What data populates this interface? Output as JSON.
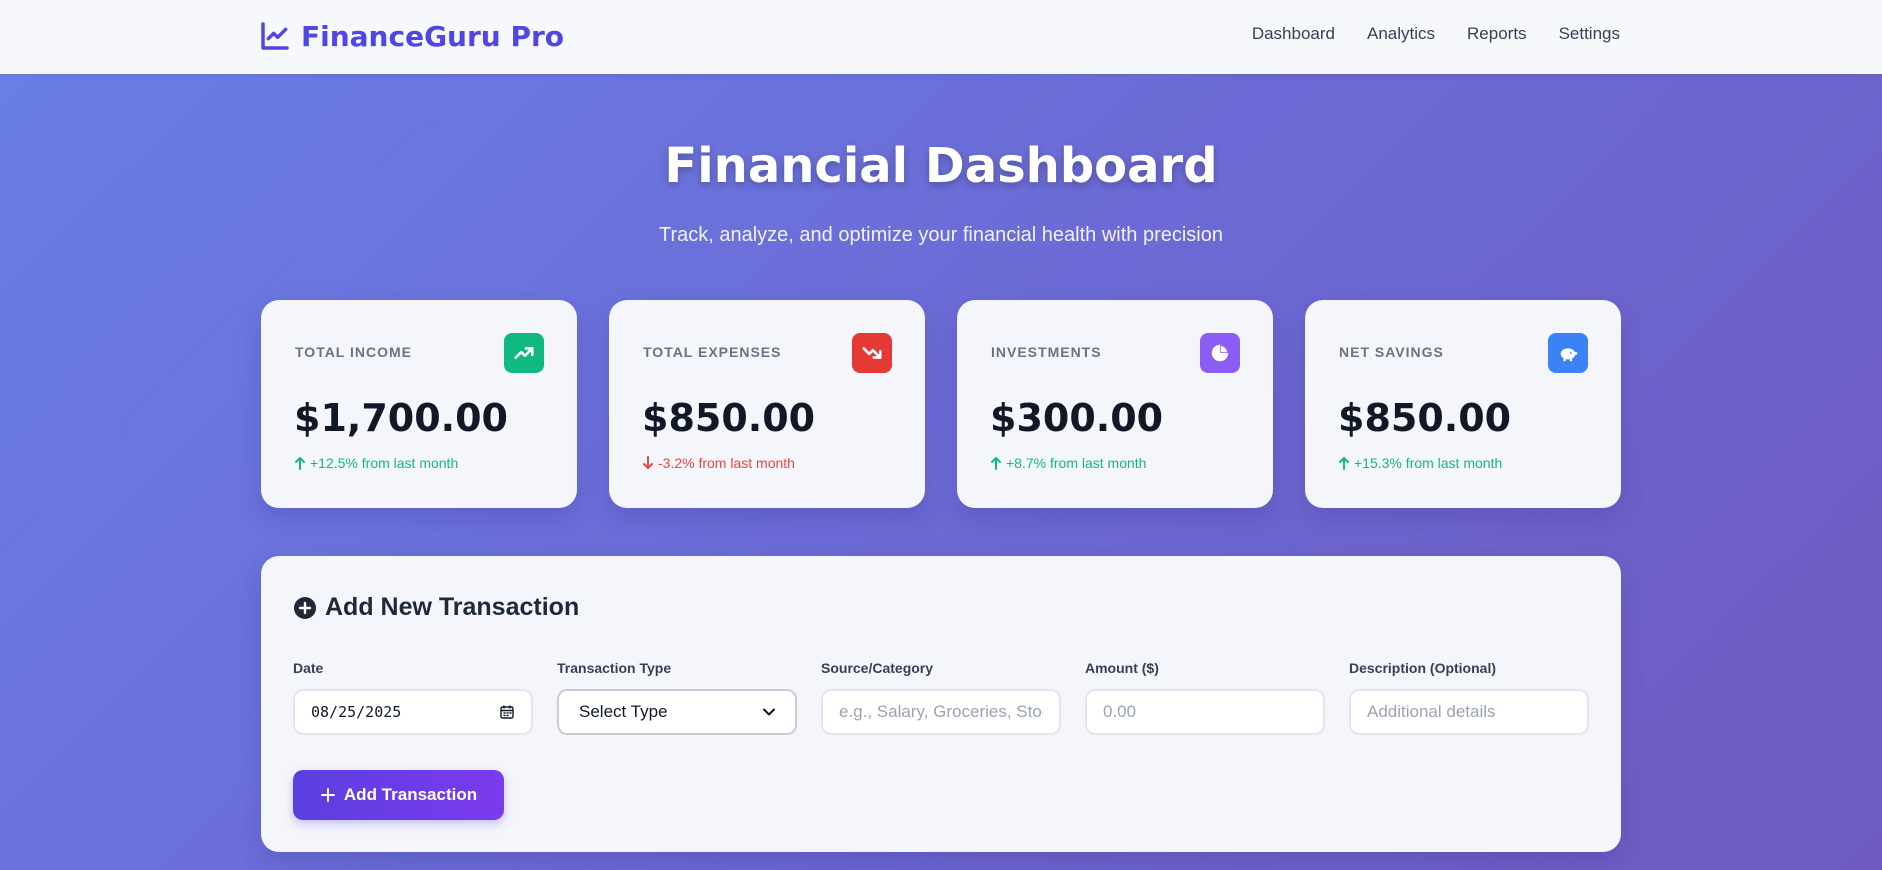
{
  "app": {
    "name": "FinanceGuru Pro",
    "brand_color": "#4f46e5"
  },
  "nav": {
    "items": [
      "Dashboard",
      "Analytics",
      "Reports",
      "Settings"
    ]
  },
  "hero": {
    "title": "Financial Dashboard",
    "subtitle": "Track, analyze, and optimize your financial health with precision"
  },
  "cards": [
    {
      "label": "TOTAL INCOME",
      "value": "$1,700.00",
      "change": "+12.5% from last month",
      "trend": "up",
      "icon": "trending-up-icon",
      "icon_color": "#10b981"
    },
    {
      "label": "TOTAL EXPENSES",
      "value": "$850.00",
      "change": "-3.2% from last month",
      "trend": "down",
      "icon": "trending-down-icon",
      "icon_color": "#ef4444"
    },
    {
      "label": "INVESTMENTS",
      "value": "$300.00",
      "change": "+8.7% from last month",
      "trend": "up",
      "icon": "pie-chart-icon",
      "icon_color": "#8b5cf6"
    },
    {
      "label": "NET SAVINGS",
      "value": "$850.00",
      "change": "+15.3% from last month",
      "trend": "up",
      "icon": "piggy-bank-icon",
      "icon_color": "#3b82f6"
    }
  ],
  "transaction_form": {
    "title": "Add New Transaction",
    "fields": {
      "date": {
        "label": "Date",
        "value": "08/25/2025"
      },
      "type": {
        "label": "Transaction Type",
        "value": "Select Type"
      },
      "source": {
        "label": "Source/Category",
        "placeholder": "e.g., Salary, Groceries, Stock"
      },
      "amount": {
        "label": "Amount ($)",
        "placeholder": "0.00"
      },
      "description": {
        "label": "Description (Optional)",
        "placeholder": "Additional details"
      }
    },
    "submit_label": "Add Transaction"
  }
}
